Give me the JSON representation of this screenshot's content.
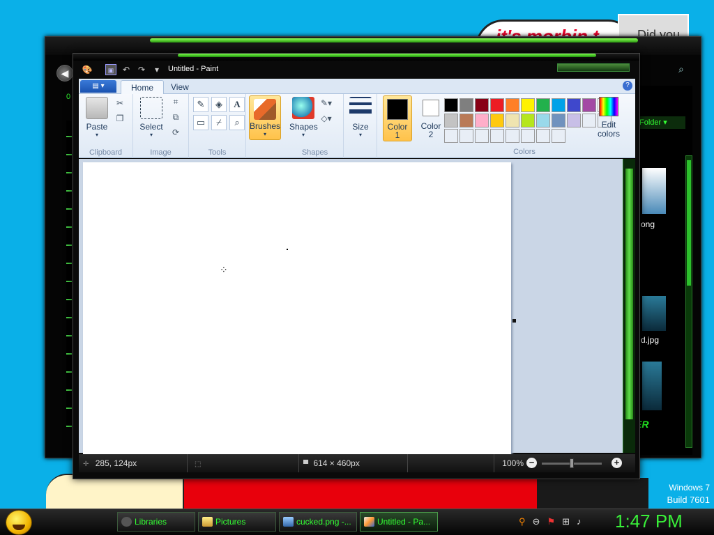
{
  "desktop": {
    "bubble_text": "it's morbin t",
    "avatar_text": "Did you",
    "os_name": "Windows 7",
    "build": "Build 7601"
  },
  "explorer": {
    "organize_label": "Folder",
    "file1": "ong",
    "file2": "d.jpg",
    "brand": "ER"
  },
  "paint": {
    "title": "Untitled - Paint",
    "tabs": [
      "Home",
      "View"
    ],
    "appmenu": "▤ ▾",
    "groups": {
      "clipboard": {
        "label": "Clipboard",
        "paste": "Paste"
      },
      "image": {
        "label": "Image",
        "select": "Select"
      },
      "tools": {
        "label": "Tools"
      },
      "brushes": {
        "label": "Brushes"
      },
      "shapes": {
        "label": "Shapes",
        "shapes_btn": "Shapes"
      },
      "size": {
        "label": "Size"
      },
      "colors": {
        "label": "Colors",
        "color1": "Color",
        "color1_num": "1",
        "color2": "Color",
        "color2_num": "2",
        "edit": "Edit colors"
      }
    },
    "palette": [
      "#000000",
      "#7f7f7f",
      "#880015",
      "#ed1c24",
      "#ff7f27",
      "#fff200",
      "#22b14c",
      "#00a2e8",
      "#3f48cc",
      "#a349a4",
      "#ffffff",
      "#c3c3c3",
      "#b97a57",
      "#ffaec9",
      "#ffc90e",
      "#efe4b0",
      "#b5e61d",
      "#99d9ea",
      "#7092be",
      "#c8bfe7",
      "#e8eef6",
      "#e8eef6",
      "#e8eef6",
      "#e8eef6",
      "#e8eef6",
      "#e8eef6",
      "#e8eef6",
      "#e8eef6",
      "#e8eef6",
      "#e8eef6"
    ],
    "status": {
      "cursor_pos": "285, 124px",
      "canvas_size": "614 × 460px",
      "zoom": "100%"
    }
  },
  "taskbar": {
    "items": [
      {
        "label": "Libraries"
      },
      {
        "label": "Pictures"
      },
      {
        "label": "cucked.png -..."
      },
      {
        "label": "Untitled - Pa..."
      }
    ],
    "clock": "1:47 PM"
  }
}
